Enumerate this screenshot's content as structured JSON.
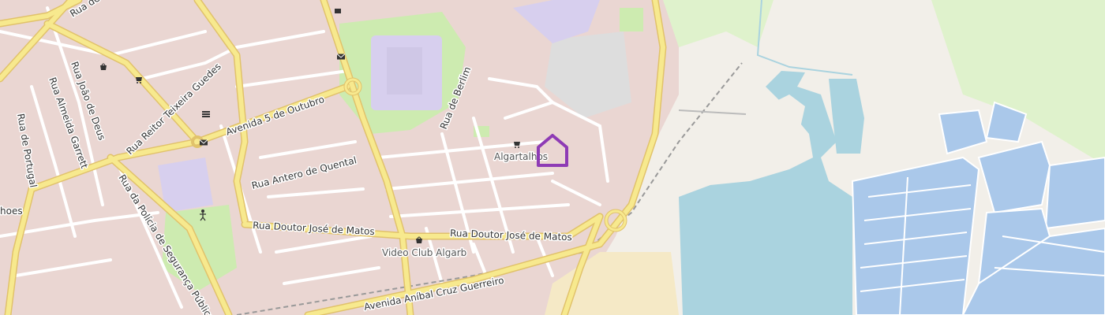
{
  "colors": {
    "land": "#f2efe9",
    "urban": "#ead6d2",
    "park": "#cdebb0",
    "water": "#aad3df",
    "saltpan": "#aac8ea",
    "major_road": "#f7e98e",
    "major_road_casing": "#e1c26b",
    "minor_road": "#ffffff",
    "industrial": "#dddddd",
    "school": "#d7cfee",
    "grass": "#dff2cc",
    "marker": "#8e3bb5"
  },
  "streets": {
    "rua_de": "Rua de",
    "rua_joao_de_deus": "Rua João de Deus",
    "rua_almeida_garrett": "Rua Almeida Garrett",
    "rua_de_portugal": "Rua de Portugal",
    "rua_reitor": "Rua Reitor Teixeira Guedes",
    "avenida_5_outubro": "Avenida 5 de Outubro",
    "rua_antero": "Rua Antero de Quental",
    "rua_de_berlim": "Rua de Berlim",
    "rua_policia": "Rua da Polícia de Segurança Pública",
    "rua_doutor_1": "Rua Doutor José de Matos",
    "rua_doutor_2": "Rua Doutor José de Matos",
    "avenida_anibal": "Avenida Aníbal Cruz Guerreiro",
    "partial_west": "hoes"
  },
  "places": {
    "algartalhos": "Algartalhos",
    "video_club": "Video Club Algarb"
  },
  "icons": [
    "shop-icon",
    "shop-icon",
    "post-office-icon",
    "post-office-icon",
    "post-office-icon",
    "bank-icon",
    "shop-icon",
    "shop-icon",
    "playground-icon",
    "home-marker-icon"
  ]
}
